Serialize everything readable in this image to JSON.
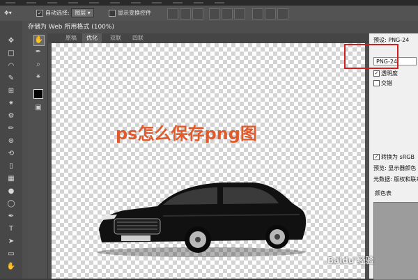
{
  "options_bar": {
    "auto_select_label": "自动选择:",
    "auto_select_value": "图层",
    "show_transform_label": "显示变换控件"
  },
  "dialog": {
    "title": "存储为 Web 所用格式 (100%)",
    "tabs": [
      {
        "label": "原稿",
        "active": false
      },
      {
        "label": "优化",
        "active": true
      },
      {
        "label": "双联",
        "active": false
      },
      {
        "label": "四联",
        "active": false
      }
    ],
    "preview_caption": "ps怎么保存png图"
  },
  "settings": {
    "preset_label": "预设:",
    "preset_value": "PNG-24",
    "format_value": "PNG-24",
    "transparency_label": "透明度",
    "transparency_checked": true,
    "interlaced_label": "交错",
    "interlaced_checked": false,
    "convert_srgb_label": "转换为 sRGB",
    "convert_srgb_checked": true,
    "preview_label": "预览:",
    "preview_value": "显示器颜色",
    "metadata_label": "元数据:",
    "metadata_value": "版权和联系信息",
    "color_table_label": "颜色表"
  },
  "colors": {
    "highlight": "#d11e1e",
    "caption": "#e05a2b"
  },
  "watermark": "Baidu 经验"
}
